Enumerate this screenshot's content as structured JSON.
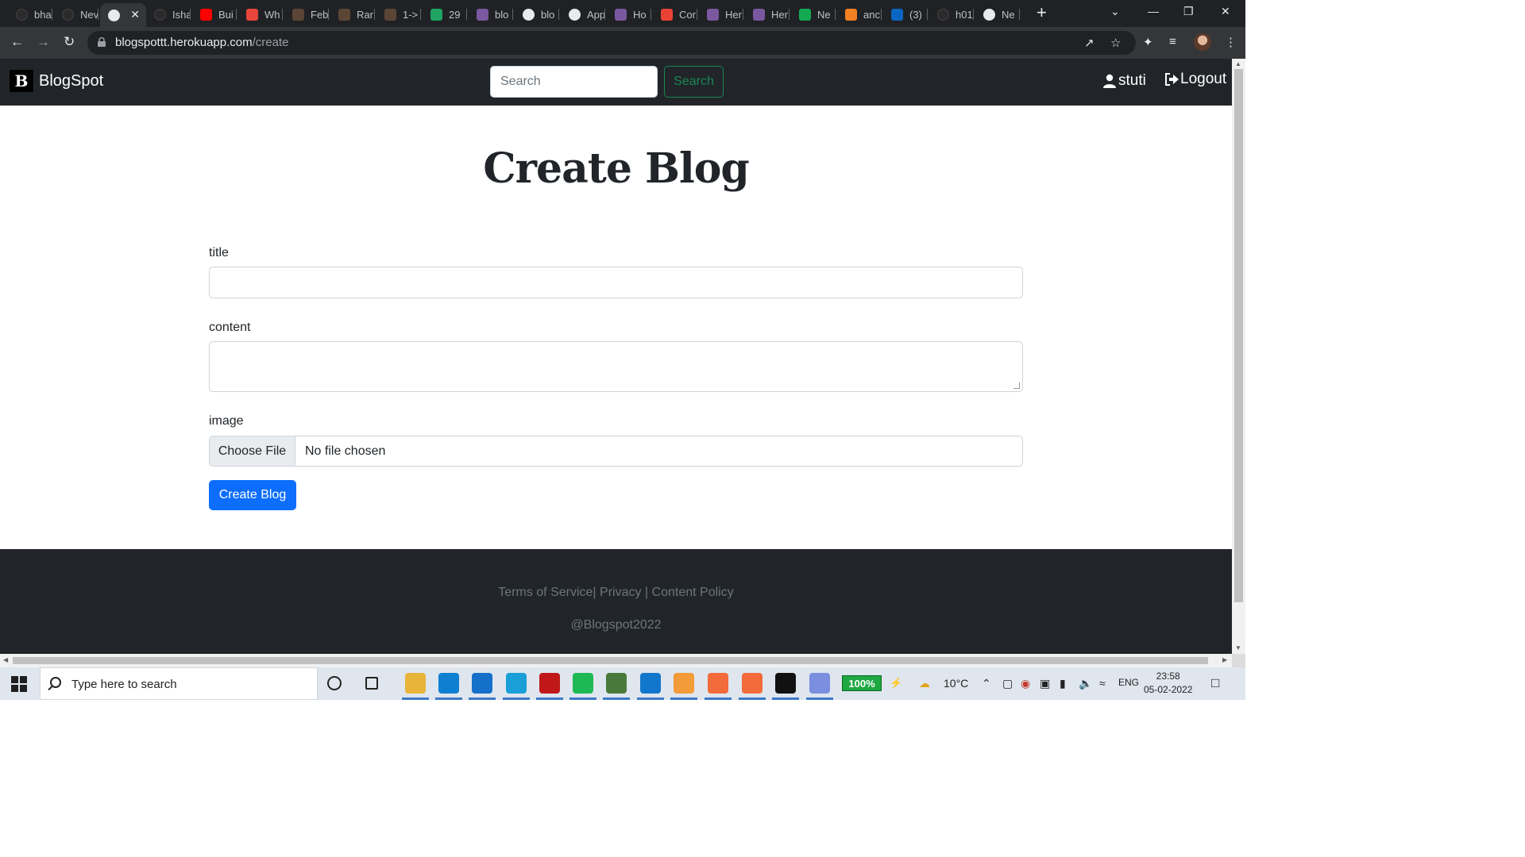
{
  "browser": {
    "tabs": [
      {
        "label": "bha",
        "icon": "github-icon",
        "color": "#2b2b2b"
      },
      {
        "label": "Nev",
        "icon": "github-icon",
        "color": "#2b2b2b"
      },
      {
        "label": "",
        "icon": "globe-icon",
        "color": "#35363a",
        "active": true
      },
      {
        "label": "Isha",
        "icon": "github-icon",
        "color": "#2b2b2b"
      },
      {
        "label": "Bui",
        "icon": "youtube-icon",
        "color": "#ff0000"
      },
      {
        "label": "Wh",
        "icon": "alert-icon",
        "color": "#e8453c"
      },
      {
        "label": "Feb",
        "icon": "codechef-icon",
        "color": "#5b4636"
      },
      {
        "label": "Rar",
        "icon": "codechef-icon",
        "color": "#5b4636"
      },
      {
        "label": "1->",
        "icon": "codechef-icon",
        "color": "#5b4636"
      },
      {
        "label": "29",
        "icon": "drive-icon",
        "color": "#1fa463"
      },
      {
        "label": "blo",
        "icon": "heroku-icon",
        "color": "#79589f"
      },
      {
        "label": "blo",
        "icon": "globe-icon",
        "color": "#2b2b2b"
      },
      {
        "label": "App",
        "icon": "globe-icon",
        "color": "#2b2b2b"
      },
      {
        "label": "Ho",
        "icon": "heroku-icon",
        "color": "#79589f"
      },
      {
        "label": "Cor",
        "icon": "gmail-icon",
        "color": "#ea4335"
      },
      {
        "label": "Her",
        "icon": "heroku-icon",
        "color": "#79589f"
      },
      {
        "label": "Her",
        "icon": "heroku-icon",
        "color": "#79589f"
      },
      {
        "label": "Ne",
        "icon": "mongodb-icon",
        "color": "#13aa52"
      },
      {
        "label": "anc",
        "icon": "stackoverflow-icon",
        "color": "#f48024"
      },
      {
        "label": "(3)",
        "icon": "linkedin-icon",
        "color": "#0a66c2"
      },
      {
        "label": "h01",
        "icon": "github-icon",
        "color": "#2b2b2b"
      },
      {
        "label": "Ne",
        "icon": "chrome-icon",
        "color": "#2b2b2b"
      }
    ],
    "new_tab_label": "+",
    "url_host": "blogspottt.herokuapp.com",
    "url_path": "/create"
  },
  "navbar": {
    "brand_logo_letter": "B",
    "brand_name": "BlogSpot",
    "search_placeholder": "Search",
    "search_button": "Search",
    "user_name": "stuti",
    "logout_label": "Logout"
  },
  "form": {
    "heading": "Create Blog",
    "title_label": "title",
    "title_value": "",
    "content_label": "content",
    "content_value": "",
    "image_label": "image",
    "file_button": "Choose File",
    "file_status": "No file chosen",
    "submit_label": "Create Blog"
  },
  "footer": {
    "links": [
      "Terms of Service",
      "Privacy",
      "Content Policy"
    ],
    "copyright": "@Blogspot2022"
  },
  "taskbar": {
    "search_placeholder": "Type here to search",
    "battery": "100%",
    "weather": "10°C",
    "language": "ENG",
    "time": "23:58",
    "date": "05-02-2022",
    "pinned": [
      {
        "icon": "cortana-icon",
        "color": "#222222"
      },
      {
        "icon": "task-view-icon",
        "color": "#222222"
      },
      {
        "icon": "file-explorer-icon",
        "color": "#e8b43a"
      },
      {
        "icon": "edge-icon",
        "color": "#0f7fd1"
      },
      {
        "icon": "mail-icon",
        "color": "#1570c9"
      },
      {
        "icon": "l-app-icon",
        "color": "#1a9fd8"
      },
      {
        "icon": "mcafee-icon",
        "color": "#c01818"
      },
      {
        "icon": "spotify-icon",
        "color": "#1db954"
      },
      {
        "icon": "chrome-icon",
        "color": "#4a7a3b"
      },
      {
        "icon": "vscode-icon",
        "color": "#1177cc"
      },
      {
        "icon": "mongodb-compass-icon",
        "color": "#f29b38"
      },
      {
        "icon": "postman-icon",
        "color": "#f26b3a"
      },
      {
        "icon": "xampp-icon",
        "color": "#f26b3a"
      },
      {
        "icon": "terminal-icon",
        "color": "#111111"
      },
      {
        "icon": "git-icon",
        "color": "#7b8ee0"
      }
    ]
  },
  "colors": {
    "navbar_bg": "#212529",
    "primary": "#0d6efd",
    "success": "#198754",
    "footer_text": "#6c757d"
  }
}
